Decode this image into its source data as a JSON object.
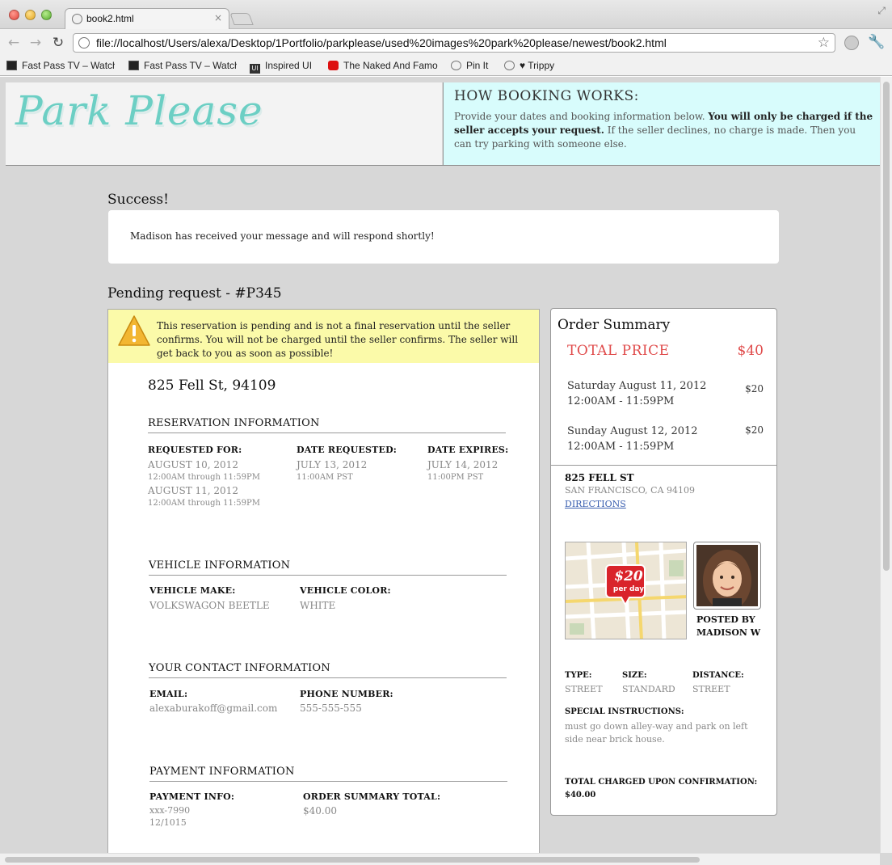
{
  "browser": {
    "tab_title": "book2.html",
    "tab_close": "×",
    "url": "file://localhost/Users/alexa/Desktop/1Portfolio/parkplease/used%20images%20park%20please/newest/book2.html",
    "back_glyph": "←",
    "forward_glyph": "→",
    "reload_glyph": "↻",
    "star_glyph": "☆",
    "wrench_glyph": "🔧",
    "bookmarks": [
      {
        "label": "Fast Pass TV – Watch",
        "icon": "tv-icon"
      },
      {
        "label": "Fast Pass TV – Watch",
        "icon": "tv-icon"
      },
      {
        "label": "Inspired UI",
        "icon": "ui-icon",
        "icon_text": "UI"
      },
      {
        "label": "The Naked And Famous",
        "icon": "youtube-icon"
      },
      {
        "label": "Pin It",
        "icon": "globe-icon"
      },
      {
        "label": "♥ Trippy",
        "icon": "globe-icon"
      }
    ]
  },
  "header": {
    "logo": "Park Please",
    "how_title": "HOW BOOKING WORKS:",
    "how_text_1": "Provide your dates and booking information below. ",
    "how_text_bold": "You will only be charged if the seller accepts your request.",
    "how_text_2": " If the seller declines, no charge is made. Then you can try parking with someone else."
  },
  "success": {
    "heading": "Success!",
    "message": "Madison has received your message and will respond shortly!"
  },
  "request": {
    "heading": "Pending request - #P345",
    "warning": "This reservation is pending and is not a final reservation until the seller confirms. You will not be charged until the seller confirms. The seller will get back to you as soon as possible!",
    "address": "825 Fell St, 94109",
    "reservation": {
      "title": "RESERVATION INFORMATION",
      "requested_for_label": "REQUESTED FOR:",
      "requested_for": [
        {
          "date": "AUGUST 10, 2012",
          "time": "12:00AM through 11:59PM"
        },
        {
          "date": "AUGUST 11, 2012",
          "time": "12:00AM through 11:59PM"
        }
      ],
      "date_requested_label": "DATE REQUESTED:",
      "date_requested": "JULY 13, 2012",
      "date_requested_time": "11:00AM PST",
      "date_expires_label": "DATE EXPIRES:",
      "date_expires": "JULY 14, 2012",
      "date_expires_time": "11:00PM PST"
    },
    "vehicle": {
      "title": "VEHICLE INFORMATION",
      "make_label": "VEHICLE MAKE:",
      "make": "VOLKSWAGON BEETLE",
      "color_label": "VEHICLE COLOR:",
      "color": "WHITE"
    },
    "contact": {
      "title": "YOUR CONTACT INFORMATION",
      "email_label": "EMAIL:",
      "email": "alexaburakoff@gmail.com",
      "phone_label": "PHONE NUMBER:",
      "phone": "555-555-555"
    },
    "payment": {
      "title": "PAYMENT INFORMATION",
      "info_label": "PAYMENT INFO:",
      "card": "xxx-7990",
      "expiry": "12/1015",
      "total_label": "ORDER SUMMARY TOTAL:",
      "total": "$40.00"
    }
  },
  "summary": {
    "title": "Order Summary",
    "total_label": "TOTAL PRICE",
    "total": "$40",
    "days": [
      {
        "date": "Saturday August 11, 2012",
        "time": "12:00AM - 11:59PM",
        "price": "$20"
      },
      {
        "date": "Sunday August 12, 2012",
        "time": "12:00AM - 11:59PM",
        "price": "$20"
      }
    ],
    "street": "825 FELL ST",
    "city": "SAN FRANCISCO, CA 94109",
    "directions": "DIRECTIONS",
    "price_tag": "$20",
    "price_tag_unit": "per day",
    "posted_by_1": "POSTED BY",
    "posted_by_2": "MADISON W",
    "type_label": "TYPE:",
    "type": "STREET",
    "size_label": "SIZE:",
    "size": "STANDARD",
    "distance_label": "DISTANCE:",
    "distance": "STREET",
    "instructions_label": "SPECIAL INSTRUCTIONS:",
    "instructions": "must go down alley-way and park on left side near brick house.",
    "charged": "TOTAL CHARGED UPON CONFIRMATION: $40.00"
  },
  "colors": {
    "accent_red": "#e04b4b",
    "logo_teal": "#6ccfc4",
    "info_bg": "#d8fcfc",
    "warning_bg": "#fbfaa9",
    "link": "#3a5fb0"
  }
}
